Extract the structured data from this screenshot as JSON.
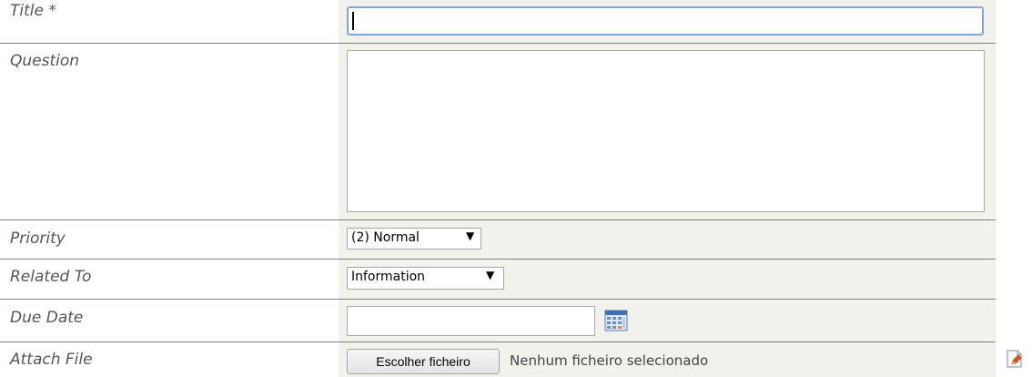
{
  "form": {
    "title": {
      "label": "Title *",
      "value": ""
    },
    "question": {
      "label": "Question",
      "value": ""
    },
    "priority": {
      "label": "Priority",
      "selected": "(2) Normal"
    },
    "related_to": {
      "label": "Related To",
      "selected": "Information"
    },
    "due_date": {
      "label": "Due Date",
      "value": ""
    },
    "attach_file": {
      "label": "Attach File",
      "button_label": "Escolher ficheiro",
      "status": "Nenhum ficheiro selecionado"
    }
  },
  "icons": {
    "dropdown": "▼",
    "calendar": "calendar-icon",
    "attach": "attach-icon"
  },
  "colors": {
    "value_cell_bg": "#f2f1ec",
    "label_text": "#555555",
    "focus_border": "#7fa6d8",
    "divider": "#7f7f7f"
  }
}
